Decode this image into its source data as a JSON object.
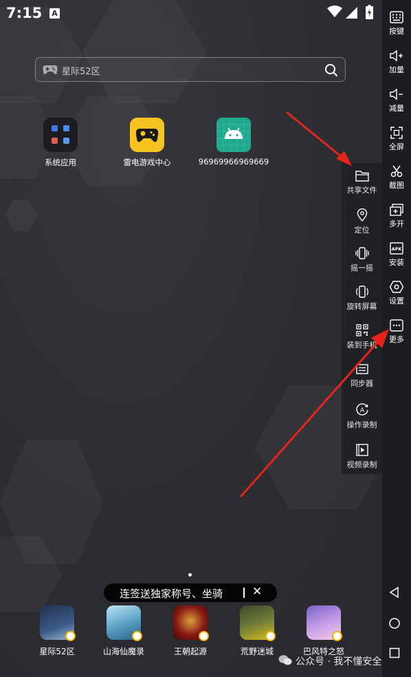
{
  "status_bar": {
    "time": "7:15",
    "notif_icon": "A"
  },
  "search": {
    "placeholder": "星际52区"
  },
  "home_apps": [
    {
      "label": "系统应用",
      "icon": "folder-icon"
    },
    {
      "label": "雷电游戏中心",
      "icon": "gamepad-icon"
    },
    {
      "label": "96969966969669",
      "icon": "android-icon"
    }
  ],
  "toolbar": {
    "items": [
      {
        "label": "按键",
        "icon": "keyboard-icon"
      },
      {
        "label": "加量",
        "icon": "volume-up-icon"
      },
      {
        "label": "减量",
        "icon": "volume-down-icon"
      },
      {
        "label": "全屏",
        "icon": "fullscreen-icon"
      },
      {
        "label": "截图",
        "icon": "scissors-icon"
      },
      {
        "label": "多开",
        "icon": "multi-instance-icon"
      },
      {
        "label": "安装",
        "icon": "apk-icon"
      },
      {
        "label": "设置",
        "icon": "settings-icon"
      },
      {
        "label": "更多",
        "icon": "more-icon"
      }
    ]
  },
  "more_panel": {
    "items": [
      {
        "label": "共享文件",
        "icon": "folder-icon"
      },
      {
        "label": "定位",
        "icon": "location-icon"
      },
      {
        "label": "摇一摇",
        "icon": "shake-icon"
      },
      {
        "label": "旋转屏幕",
        "icon": "rotate-icon"
      },
      {
        "label": "装到手机",
        "icon": "qrcode-icon"
      },
      {
        "label": "同步器",
        "icon": "sync-icon"
      },
      {
        "label": "操作录制",
        "icon": "record-icon"
      },
      {
        "label": "视频录制",
        "icon": "video-icon"
      }
    ]
  },
  "banner": {
    "text": "连签送独家称号、坐骑",
    "close": "✕"
  },
  "dock_apps": [
    {
      "label": "星际52区",
      "color": "#3a5a86"
    },
    {
      "label": "山海仙魔录",
      "color": "#5fa5c8"
    },
    {
      "label": "王朝起源",
      "color": "#8a1a12"
    },
    {
      "label": "荒野迷城",
      "color": "#6d7a3a"
    },
    {
      "label": "巴风特之怒",
      "color": "#c9a0e8"
    }
  ],
  "watermark": {
    "text": "公众号 · 我不懂安全"
  },
  "colors": {
    "arrow": "#e8231a",
    "toolbar_bg": "#1b1d21",
    "panel_bg": "#1f2125"
  }
}
